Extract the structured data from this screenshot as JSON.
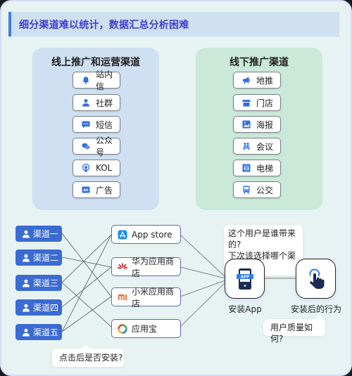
{
  "banner": {
    "title": "细分渠道难以统计，数据汇总分析困难"
  },
  "online": {
    "title": "线上推广和运营渠道",
    "items": [
      {
        "label": "站内信",
        "icon": "bell-icon"
      },
      {
        "label": "社群",
        "icon": "user-icon"
      },
      {
        "label": "短信",
        "icon": "message-icon"
      },
      {
        "label": "公众号",
        "icon": "wechat-icon"
      },
      {
        "label": "KOL",
        "icon": "broadcast-icon"
      },
      {
        "label": "广告",
        "icon": "ad-icon"
      }
    ]
  },
  "offline": {
    "title": "线下推广渠道",
    "items": [
      {
        "label": "地推",
        "icon": "megaphone-icon"
      },
      {
        "label": "门店",
        "icon": "storefront-icon"
      },
      {
        "label": "海报",
        "icon": "poster-icon"
      },
      {
        "label": "会议",
        "icon": "meeting-icon"
      },
      {
        "label": "电梯",
        "icon": "elevator-icon"
      },
      {
        "label": "公交",
        "icon": "bus-icon"
      }
    ]
  },
  "channels": [
    {
      "label": "渠道一"
    },
    {
      "label": "渠道二"
    },
    {
      "label": "渠道三"
    },
    {
      "label": "渠道四"
    },
    {
      "label": "渠道五"
    }
  ],
  "stores": [
    {
      "label": "App store",
      "icon": "app-store-icon"
    },
    {
      "label": "华为应用商店",
      "icon": "huawei-icon"
    },
    {
      "label": "小米应用商店",
      "icon": "xiaomi-icon"
    },
    {
      "label": "应用宝",
      "icon": "yingyongbao-icon"
    }
  ],
  "links": [
    {
      "from": 0,
      "to": 2
    },
    {
      "from": 1,
      "to": 1
    },
    {
      "from": 2,
      "to": 0
    },
    {
      "from": 2,
      "to": 3
    },
    {
      "from": 3,
      "to": 1
    },
    {
      "from": 4,
      "to": 0
    },
    {
      "from": 4,
      "to": 2
    }
  ],
  "install": {
    "label": "安装App",
    "badge": "APP"
  },
  "behavior": {
    "label": "安装后的行为"
  },
  "questions": {
    "source_line1": "这个用户是谁带来的?",
    "source_line2": "下次该选择哪个渠道?",
    "installed": "点击后是否安装?",
    "quality": "用户质量如何?"
  },
  "colors": {
    "accent": "#3b6bd2",
    "banner_text": "#3f3fd0",
    "online_panel": "#cfe0f2",
    "offline_panel": "#cae9d9",
    "icon_blue": "#2f6de6",
    "dark_navy": "#1b2b55"
  }
}
